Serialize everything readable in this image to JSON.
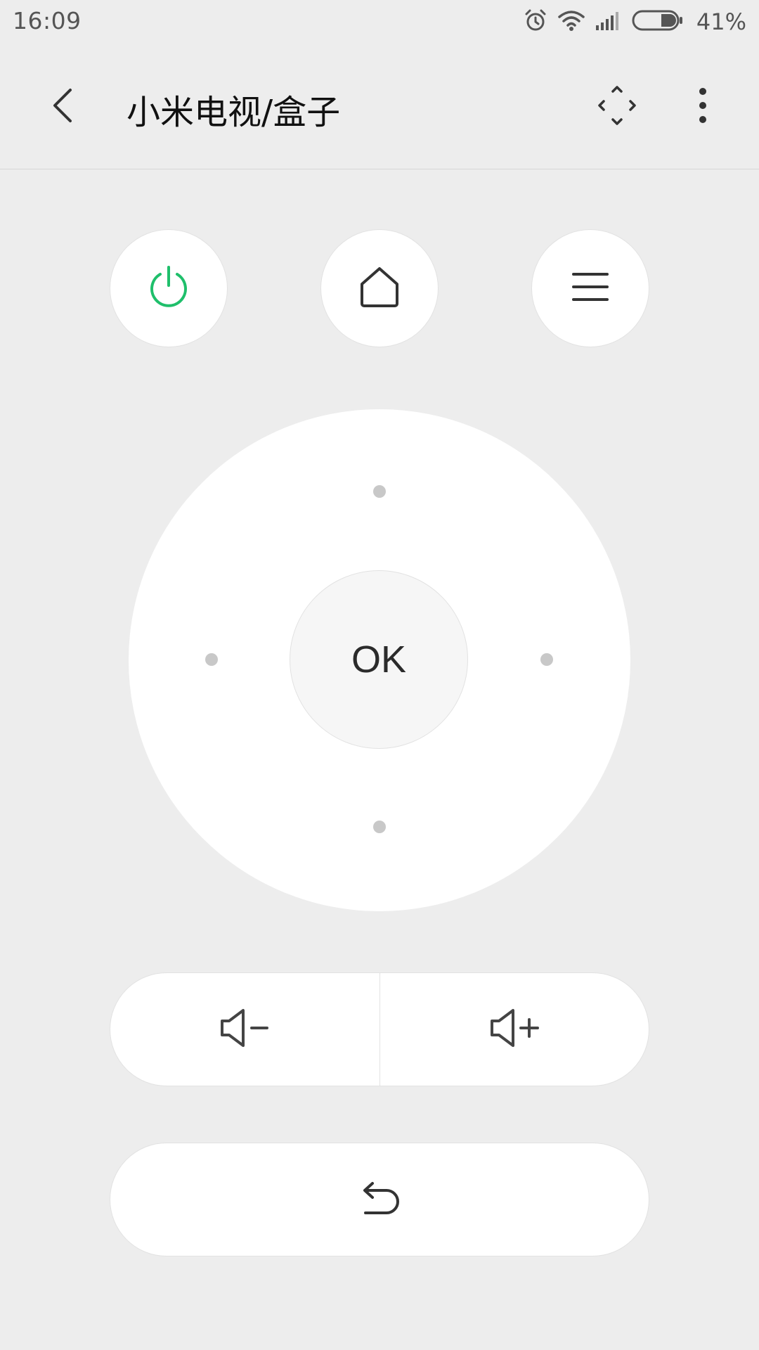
{
  "status_bar": {
    "time": "16:09",
    "battery_percent": "41%",
    "icons": [
      "alarm-icon",
      "wifi-icon",
      "signal-icon",
      "battery-icon"
    ]
  },
  "header": {
    "title": "小米电视/盒子",
    "back_icon": "chevron-left-icon",
    "expand_icon": "expand-arrows-icon",
    "more_icon": "more-vertical-icon"
  },
  "top_buttons": [
    {
      "name": "power",
      "icon": "power-icon",
      "color": "#1fbf6b"
    },
    {
      "name": "home",
      "icon": "home-icon"
    },
    {
      "name": "menu",
      "icon": "menu-icon"
    }
  ],
  "dpad": {
    "ok_label": "OK",
    "directions": [
      "up",
      "down",
      "left",
      "right"
    ]
  },
  "volume": {
    "down_icon": "volume-down-icon",
    "up_icon": "volume-up-icon"
  },
  "back": {
    "icon": "return-arrow-icon"
  },
  "colors": {
    "background": "#ededed",
    "button": "#ffffff",
    "ok_button": "#f6f6f6",
    "accent_power": "#1fbf6b",
    "icon": "#333333",
    "dpad_dot": "#c8c8c8"
  }
}
